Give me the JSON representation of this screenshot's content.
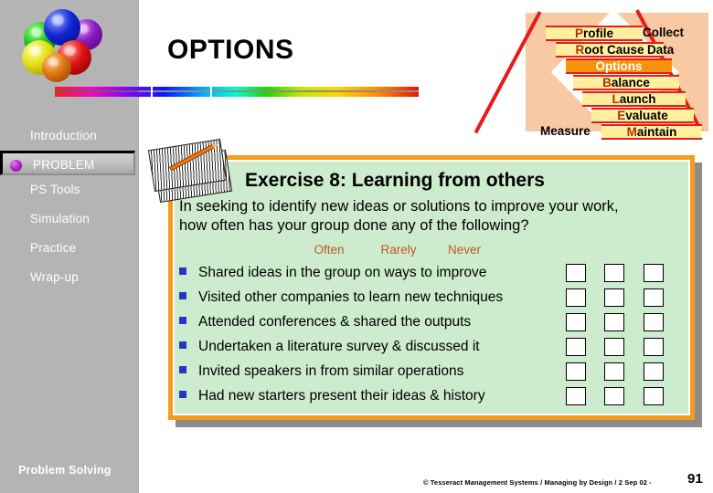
{
  "slide": {
    "title": "OPTIONS",
    "footer_credit": "© Tesseract Management Systems / Managing by Design / 2 Sep 02  -",
    "page_number": "91"
  },
  "sidebar": {
    "section_label": "Problem Solving",
    "items": [
      {
        "label": "Introduction",
        "selected": false
      },
      {
        "label": "PROBLEM",
        "selected": true
      },
      {
        "label": "PS Tools",
        "selected": false
      },
      {
        "label": "Simulation",
        "selected": false
      },
      {
        "label": "Practice",
        "selected": false
      },
      {
        "label": "Wrap-up",
        "selected": false
      }
    ]
  },
  "diagram": {
    "left_label": "Measure",
    "right_label_line1": "Collect",
    "right_label_line2": "Data",
    "steps": [
      {
        "cap": "P",
        "rest": "rofile",
        "highlight": false
      },
      {
        "cap": "R",
        "rest": "oot Cause",
        "highlight": false
      },
      {
        "cap": "O",
        "rest": "ptions",
        "highlight": true
      },
      {
        "cap": "B",
        "rest": "alance",
        "highlight": false
      },
      {
        "cap": "L",
        "rest": "aunch",
        "highlight": false
      },
      {
        "cap": "E",
        "rest": "valuate",
        "highlight": false
      },
      {
        "cap": "M",
        "rest": "aintain",
        "highlight": false
      }
    ]
  },
  "exercise": {
    "title": "Exercise 8: Learning from others",
    "prompt_line1": "In seeking to identify new ideas or solutions to improve your work,",
    "prompt_line2": "how often has your group done any of the following?",
    "columns": [
      "Often",
      "Rarely",
      "Never"
    ],
    "questions": [
      "Shared ideas in the group on ways to improve",
      "Visited other companies to learn new techniques",
      "Attended conferences & shared the outputs",
      "Undertaken a literature survey & discussed it",
      "Invited speakers in from similar operations",
      "Had new starters present their ideas & history"
    ]
  },
  "colors": {
    "card_border": "#f59c1a",
    "card_bg": "#cdebcd",
    "sidebar_bg": "#b4b4b4",
    "highlight_step": "#f5930d",
    "band_bg": "#ffef9e",
    "band_edge": "#e81b17",
    "bowtie_bg": "#f8c9a2",
    "column_header": "#c0552a",
    "bullet": "#2436c8"
  }
}
